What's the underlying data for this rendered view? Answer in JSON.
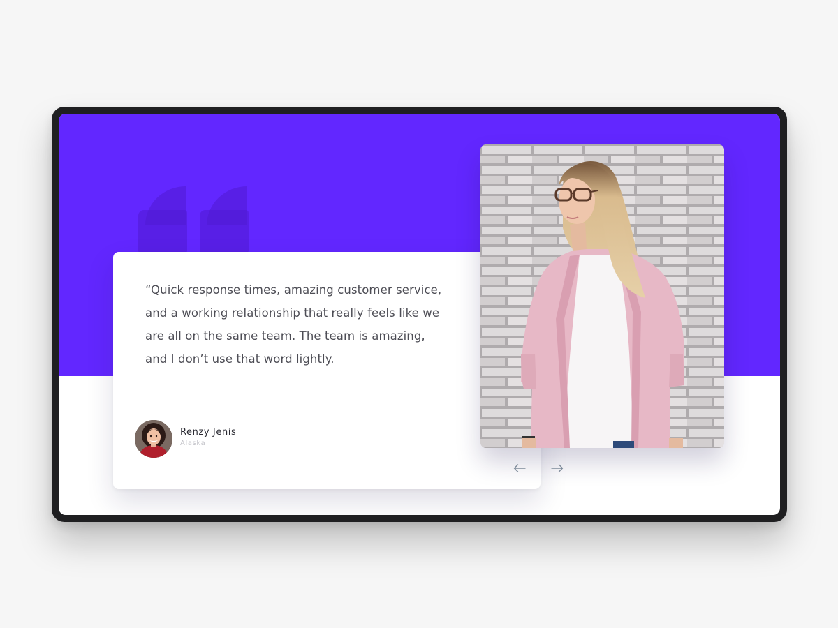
{
  "theme": {
    "accent": "#6227FF",
    "frame": "#1F1F21",
    "background": "#F6F6F6"
  },
  "testimonial": {
    "quote_lines": [
      "“Quick response times, amazing customer service,",
      "and a working relationship that really feels like we",
      "are all on the same team. The team is amazing,",
      "and I don’t use that word lightly."
    ],
    "author": {
      "name": "Renzy Jenis",
      "location": "Alaska",
      "avatar_icon": "avatar-portrait"
    }
  },
  "decor": {
    "quote_icon": "quote-mark-icon"
  },
  "photo": {
    "icon": "portrait-photo"
  },
  "nav": {
    "prev_icon": "arrow-left-icon",
    "next_icon": "arrow-right-icon"
  }
}
